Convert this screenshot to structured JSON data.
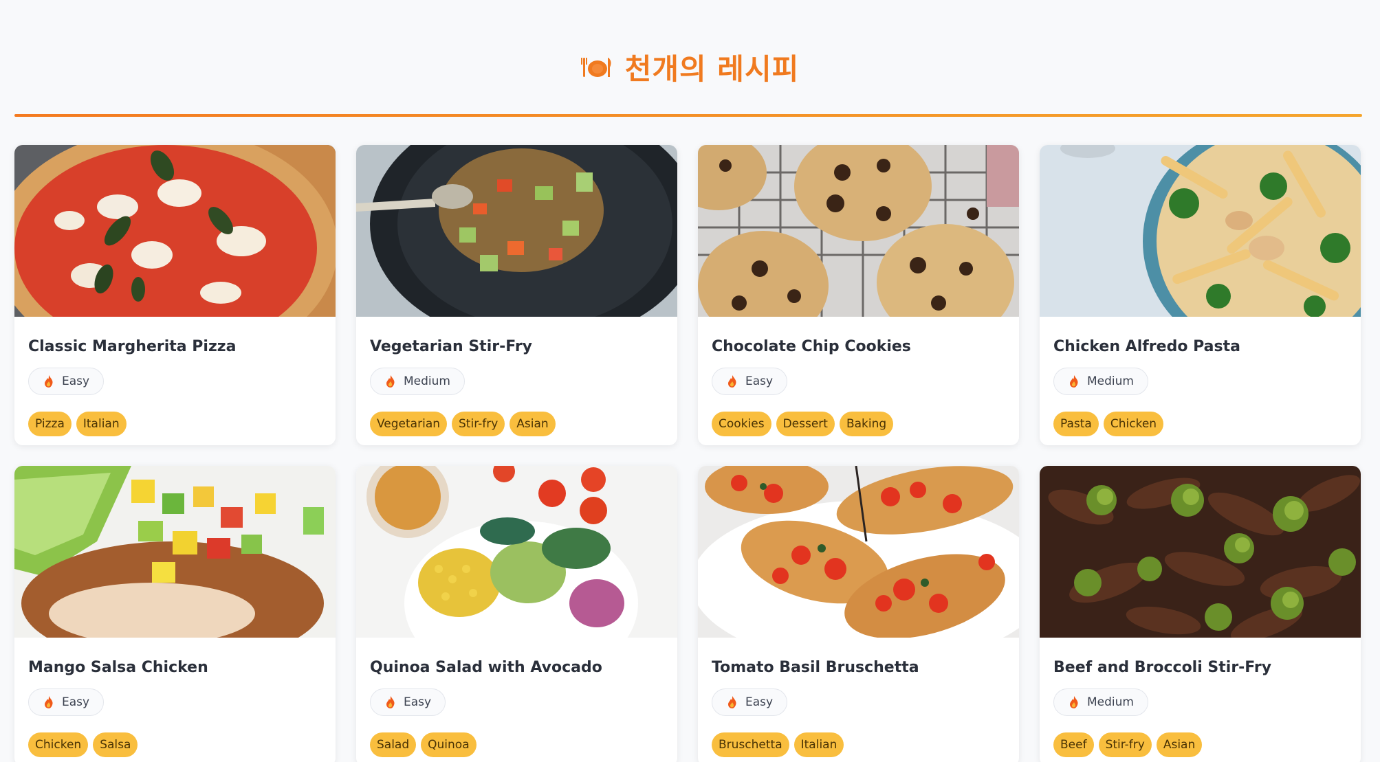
{
  "header": {
    "icon": "plate-utensils-icon",
    "title": "천개의 레시피"
  },
  "colors": {
    "accent": "#f07a1f",
    "tag_bg": "#f9be3e",
    "page_bg": "#f8f9fb"
  },
  "recipes": [
    {
      "title": "Classic Margherita Pizza",
      "difficulty": "Easy",
      "tags": [
        "Pizza",
        "Italian"
      ],
      "image_icon": "pizza-photo"
    },
    {
      "title": "Vegetarian Stir-Fry",
      "difficulty": "Medium",
      "tags": [
        "Vegetarian",
        "Stir-fry",
        "Asian"
      ],
      "image_icon": "stir-fry-photo"
    },
    {
      "title": "Chocolate Chip Cookies",
      "difficulty": "Easy",
      "tags": [
        "Cookies",
        "Dessert",
        "Baking"
      ],
      "image_icon": "cookies-photo"
    },
    {
      "title": "Chicken Alfredo Pasta",
      "difficulty": "Medium",
      "tags": [
        "Pasta",
        "Chicken"
      ],
      "image_icon": "pasta-photo"
    },
    {
      "title": "Mango Salsa Chicken",
      "difficulty": "Easy",
      "tags": [
        "Chicken",
        "Salsa"
      ],
      "image_icon": "salsa-chicken-photo"
    },
    {
      "title": "Quinoa Salad with Avocado",
      "difficulty": "Easy",
      "tags": [
        "Salad",
        "Quinoa"
      ],
      "image_icon": "salad-photo"
    },
    {
      "title": "Tomato Basil Bruschetta",
      "difficulty": "Easy",
      "tags": [
        "Bruschetta",
        "Italian"
      ],
      "image_icon": "bruschetta-photo"
    },
    {
      "title": "Beef and Broccoli Stir-Fry",
      "difficulty": "Medium",
      "tags": [
        "Beef",
        "Stir-fry",
        "Asian"
      ],
      "image_icon": "beef-broccoli-photo"
    }
  ]
}
